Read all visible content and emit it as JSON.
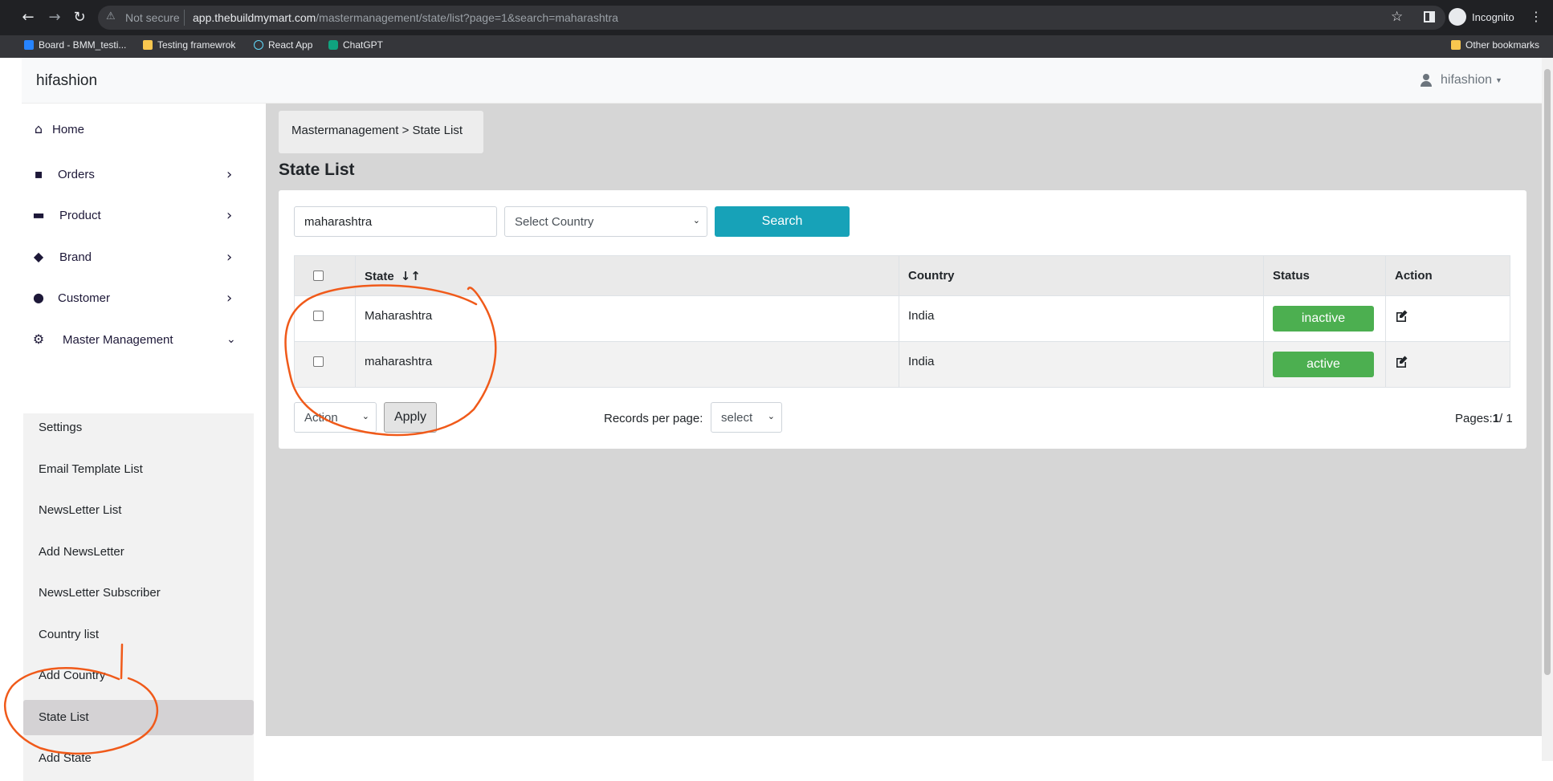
{
  "browser": {
    "security_label": "Not secure",
    "url_host": "app.thebuildmymart.com",
    "url_path": "/mastermanagement/state/list?page=1&search=maharashtra",
    "profile_label": "Incognito",
    "bookmarks": [
      "Board - BMM_testi...",
      "Testing framewrok",
      "React App",
      "ChatGPT"
    ],
    "other_bookmarks": "Other bookmarks"
  },
  "navbar": {
    "brand": "hifashion",
    "user": "hifashion"
  },
  "sidebar": {
    "items": [
      {
        "label": "Home",
        "icon": "home-icon"
      },
      {
        "label": "Orders",
        "icon": "shopping-bag-icon"
      },
      {
        "label": "Product",
        "icon": "archive-box-icon"
      },
      {
        "label": "Brand",
        "icon": "tags-icon"
      },
      {
        "label": "Customer",
        "icon": "user-icon"
      },
      {
        "label": "Master Management",
        "icon": "user-gear-icon"
      }
    ],
    "submenu": [
      "Settings",
      "Email Template List",
      "NewsLetter List",
      "Add NewsLetter",
      "NewsLetter Subscriber",
      "Country list",
      "Add Country",
      "State List",
      "Add State"
    ],
    "active_submenu": "State List"
  },
  "main": {
    "breadcrumb": "Mastermanagement > State List",
    "title": "State List",
    "search": {
      "value": "maharashtra",
      "country_placeholder": "Select Country",
      "button": "Search"
    },
    "table": {
      "headers": [
        "State",
        "Country",
        "Status",
        "Action"
      ],
      "rows": [
        {
          "state": "Maharashtra",
          "country": "India",
          "status": "inactive"
        },
        {
          "state": "maharashtra",
          "country": "India",
          "status": "active"
        }
      ]
    },
    "footer": {
      "bulk_action": "Action",
      "apply": "Apply",
      "records_label": "Records per page:",
      "records_select": "select",
      "pages_label": "Pages:",
      "current_page": "1",
      "total_pages": "/ 1"
    }
  },
  "colors": {
    "search_button": "#17a2b8",
    "status_badge": "#4caf50",
    "annotation": "#f05a1a",
    "content_bg": "#d6d6d6"
  }
}
